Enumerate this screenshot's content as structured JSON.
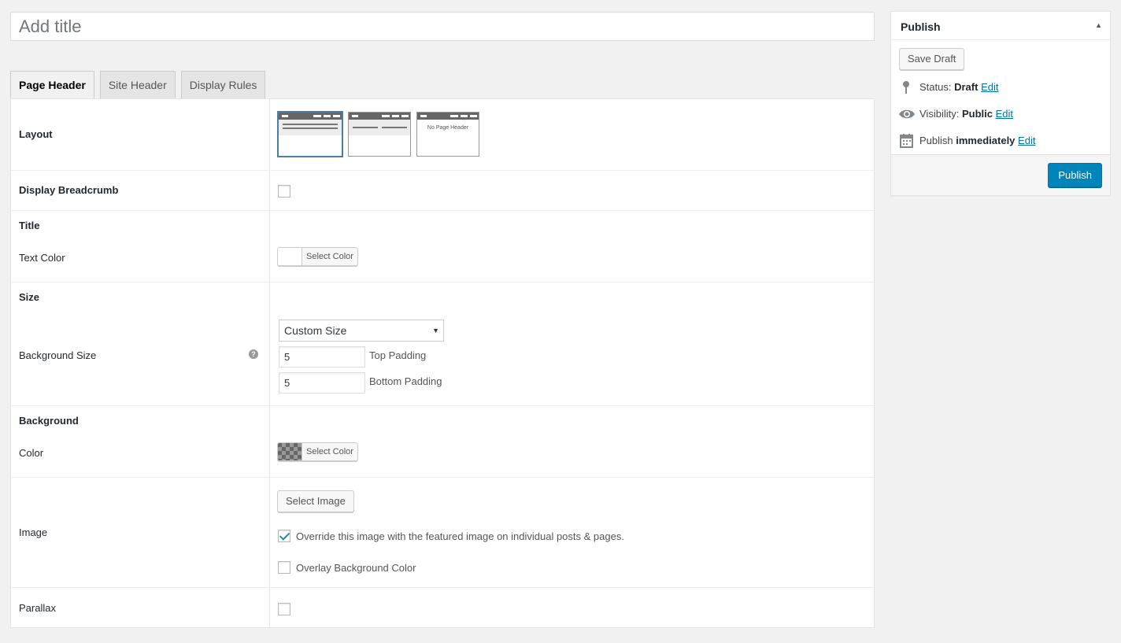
{
  "title_field": {
    "placeholder": "Add title",
    "value": ""
  },
  "tabs": [
    {
      "label": "Page Header",
      "active": true
    },
    {
      "label": "Site Header",
      "active": false
    },
    {
      "label": "Display Rules",
      "active": false
    }
  ],
  "rows": {
    "layout": {
      "label": "Layout",
      "no_header_option": "No Page Header"
    },
    "breadcrumb": {
      "label": "Display Breadcrumb",
      "checked": false
    },
    "title": {
      "heading": "Title",
      "text_color_label": "Text Color",
      "color_button": "Select Color"
    },
    "size": {
      "heading": "Size",
      "label": "Background Size",
      "help": "?",
      "select_value": "Custom Size",
      "top_padding_value": "5",
      "top_padding_label": "Top Padding",
      "bottom_padding_value": "5",
      "bottom_padding_label": "Bottom Padding"
    },
    "background": {
      "heading": "Background",
      "color_label": "Color",
      "color_button": "Select Color"
    },
    "image": {
      "label": "Image",
      "select_button": "Select Image",
      "override_label": "Override this image with the featured image on individual posts & pages.",
      "override_checked": true,
      "overlay_label": "Overlay Background Color",
      "overlay_checked": false
    },
    "parallax": {
      "label": "Parallax",
      "checked": false
    }
  },
  "publish": {
    "title": "Publish",
    "save_draft": "Save Draft",
    "status_label": "Status:",
    "status_value": "Draft",
    "visibility_label": "Visibility:",
    "visibility_value": "Public",
    "publish_label": "Publish",
    "publish_value": "immediately",
    "edit": "Edit",
    "publish_button": "Publish"
  },
  "colors": {
    "accent": "#0085ba",
    "link": "#0073aa",
    "selected_layout_border": "#4a7fa0"
  },
  "icons": {
    "toggle": "triangle-up-icon",
    "status": "pin-icon",
    "visibility": "eye-icon",
    "schedule": "calendar-icon",
    "select_arrow": "caret-down-icon"
  }
}
